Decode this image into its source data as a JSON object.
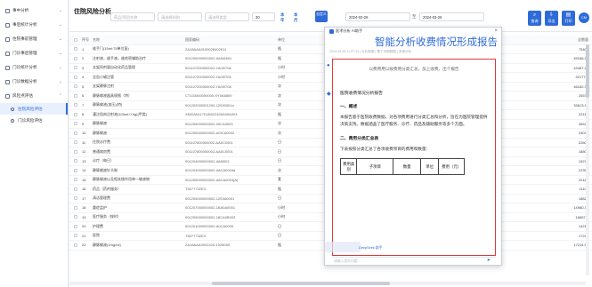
{
  "sidebar": {
    "items": [
      {
        "label": "事中分析"
      },
      {
        "label": "事后统计分析"
      },
      {
        "label": "住院事前管理"
      },
      {
        "label": "门诊事后管理"
      },
      {
        "label": "门诊统计分析"
      },
      {
        "label": "门诊数据分析"
      },
      {
        "label": "风险点评估"
      }
    ],
    "subs": [
      {
        "label": "住院风险评估"
      },
      {
        "label": "门诊风险评估"
      }
    ]
  },
  "toolbar": {
    "title": "住院风险分析",
    "search1_placeholder": "药品/项目名称",
    "search2_placeholder": "请选择科别",
    "search3_placeholder": "请选择类型",
    "page_size": "30",
    "label_a": "本年",
    "label_b": "本月",
    "label_c": "自定义",
    "date_start": "2024-02-26",
    "date_sep": "至",
    "date_end": "2024-03-26",
    "btn_search": "查询",
    "btn_export": "导出",
    "btn_print": "打印",
    "avatar": "CM"
  },
  "grid": {
    "headers": {
      "no": "序号",
      "name": "名称",
      "code": "国家编码",
      "unit": "单位",
      "right": "总数量"
    },
    "rows": [
      {
        "no": "1",
        "name": "维手门(15ml:75单位复)",
        "code": "ZA18AAA0190028402911",
        "unit": "瓶",
        "right": "75407"
      },
      {
        "no": "2",
        "name": "注射液，维手液，维他密辅助治疗",
        "code": "001205000000002-A8I0A601",
        "unit": "瓶",
        "right": "45186.25"
      },
      {
        "no": "3",
        "name": "支架同剂量自动化药品管理",
        "code": "001107200000002-YA0I0706",
        "unit": "小时",
        "right": "43487.22"
      },
      {
        "no": "4",
        "name": "全血小输注管",
        "code": "001107200000002-YA0I0705",
        "unit": "小时",
        "right": "42177.5"
      },
      {
        "no": "5",
        "name": "支架静脉注射",
        "code": "001107200000002-YA0I0708",
        "unit": "次",
        "right": "46182.36"
      },
      {
        "no": "6",
        "name": "静脉输液器具规格（特）",
        "code": "CT133400000000-XY0A6809",
        "unit": "次",
        "right": "25577"
      },
      {
        "no": "7",
        "name": "静脉输液(加压)(特)",
        "code": "001202000001200-12030001a",
        "unit": "次",
        "right": "33613.17"
      },
      {
        "no": "8",
        "name": "灌注肌肉注射液(100ml:0.9g)(甲类)",
        "code": "X600A0417D1B022400A09A003",
        "unit": "瓶",
        "right": "22415"
      },
      {
        "no": "9",
        "name": "静脉输液",
        "code": "001205000000002-00CA0003",
        "unit": "次",
        "right": "26533"
      },
      {
        "no": "10",
        "name": "静脉输液",
        "code": "001205000000002-A0ICA0002",
        "unit": "次",
        "right": "23031"
      },
      {
        "no": "11",
        "name": "住院诊疗费",
        "code": "001107600000002-AA0C0001",
        "unit": "日",
        "right": "22601"
      },
      {
        "no": "12",
        "name": "普通病房费",
        "code": "001107800000002-AA0C0001",
        "unit": "日",
        "right": "18800"
      },
      {
        "no": "13",
        "name": "诊疗（每日）",
        "code": "001204000000002-A8I0002",
        "unit": "日",
        "right": "15275"
      },
      {
        "no": "14",
        "name": "静脉输液针头制",
        "code": "001204000000002-A8CA0003a",
        "unit": "次",
        "right": "22354"
      },
      {
        "no": "15",
        "name": "静脉输液以及相关操作用单一输液物",
        "code": "001205000000002-A8CA0003(A)",
        "unit": "套",
        "right": "22182"
      },
      {
        "no": "16",
        "name": "药品（药剂服务）",
        "code": "T5077732E3",
        "unit": "瓶",
        "right": "11101"
      },
      {
        "no": "17",
        "name": "清洁管理费",
        "code": "001205000000002-1203A0001",
        "unit": "日",
        "right": "18823"
      },
      {
        "no": "18",
        "name": "重症监护",
        "code": "001207000000002-1BA0A0001",
        "unit": "小时",
        "right": "14980.33"
      },
      {
        "no": "19",
        "name": "医疗服务（按时）",
        "code": "001209000000002-18CA0B003",
        "unit": "小时",
        "right": "16667.3"
      },
      {
        "no": "20",
        "name": "护理费",
        "code": "001201000000002-A0CA0005",
        "unit": "日",
        "right": "14215"
      },
      {
        "no": "21",
        "name": "医院",
        "code": "T5077732E3",
        "unit": "日",
        "right": "17244"
      },
      {
        "no": "22",
        "name": "静脉输液(1mg/ml)",
        "code": "ZA18AAA0002420-1028055",
        "unit": "瓶",
        "right": "17214.59"
      }
    ]
  },
  "popup": {
    "header": "医术分析 AI助手",
    "title": "智能分析收费情况形成报告",
    "subtitle": "2024-03-26 11:57:34 | 分析数据 | 基于本期数据 | 多维分析",
    "hint": "以费用用以按费用分类汇总，加上收费，出个报告",
    "section_title": "医院收费情况分析报告",
    "h_overview": "一、概述",
    "overview_text": "本报告基于医院收费数据，对各项费用进行分类汇总和分析，旨在为医院管理提供决策支持。数据涵盖了医疗服务、诊疗、药品及辅助服务等多个方面。",
    "h_summary": "二、费用分类汇总表",
    "summary_text": "下表按照分类汇总了各项收费项目的费用和数量：",
    "table_headers": [
      "费用类别",
      "子项目",
      "数量",
      "单位",
      "费用（元）"
    ],
    "input_placeholder": "请输入您的问题...",
    "footer": "DeepSeek 助手"
  }
}
